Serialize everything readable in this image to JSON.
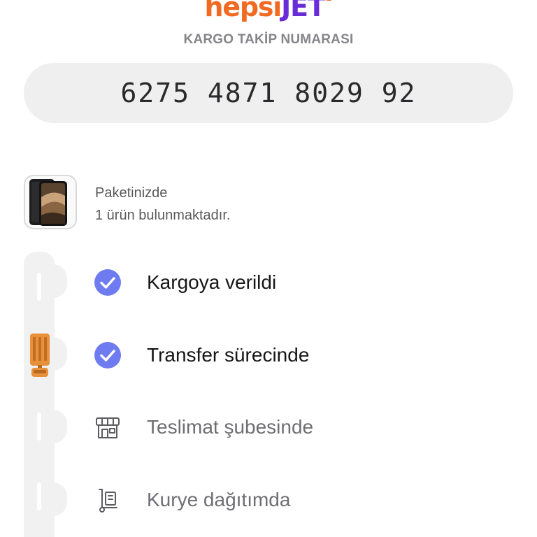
{
  "brand": {
    "part1": "hepsi",
    "part2": "JET"
  },
  "tracking": {
    "label": "KARGO TAKİP NUMARASI",
    "number": "6275 4871 8029 92"
  },
  "package": {
    "line1": "Paketinizde",
    "line2": "1 ürün bulunmaktadır."
  },
  "steps": [
    {
      "label": "Kargoya verildi",
      "status": "done",
      "icon": "check-circle-icon"
    },
    {
      "label": "Transfer sürecinde",
      "status": "done",
      "icon": "check-circle-icon"
    },
    {
      "label": "Teslimat şubesinde",
      "status": "pending",
      "icon": "store-icon"
    },
    {
      "label": "Kurye dağıtımda",
      "status": "pending",
      "icon": "courier-icon"
    }
  ],
  "colors": {
    "brand_orange": "#f26a21",
    "brand_purple": "#6a2cd8",
    "check_blue": "#6f7cf1",
    "truck": "#e8913a"
  }
}
